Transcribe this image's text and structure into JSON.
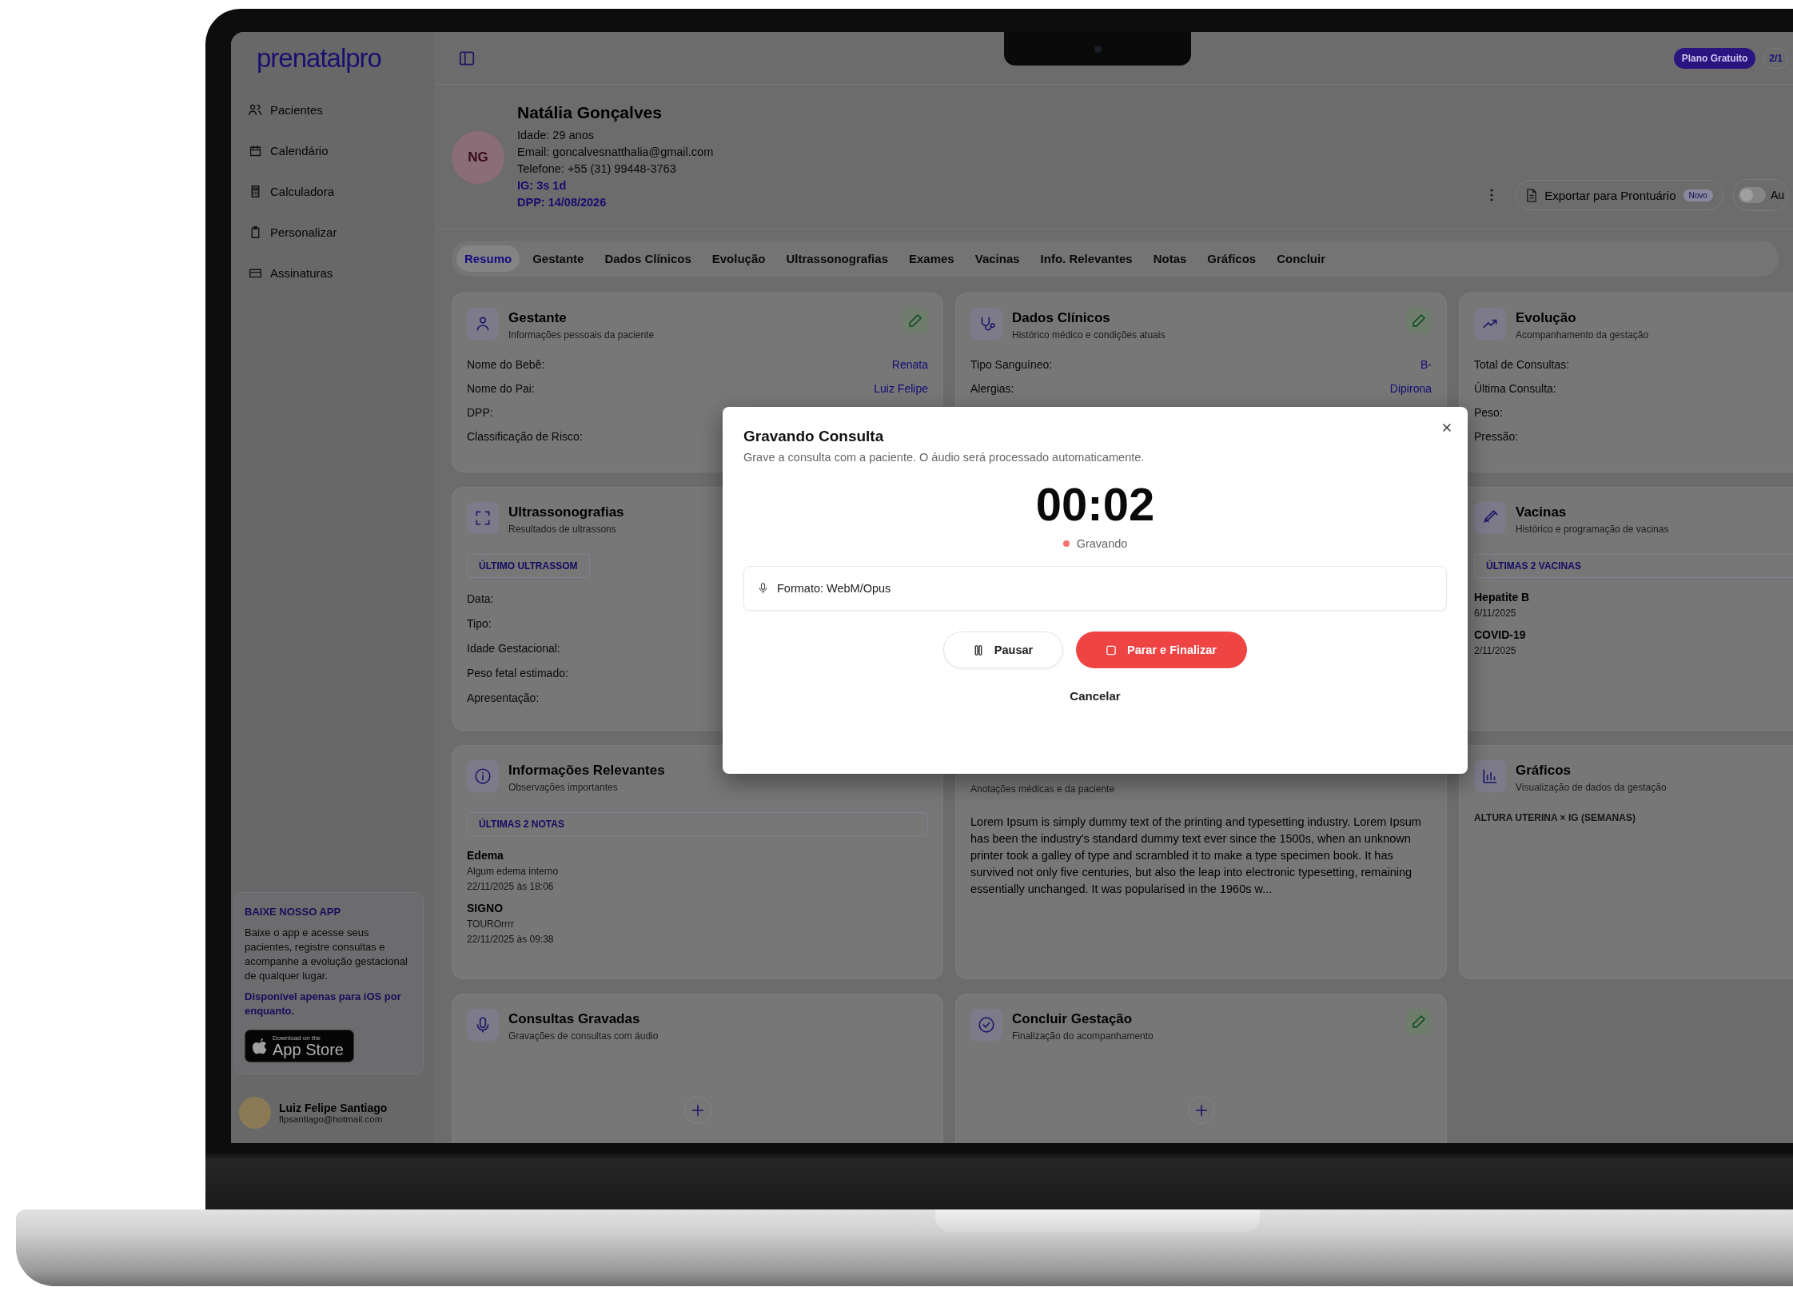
{
  "sidebar": {
    "logo": "prenatalpro",
    "nav": [
      {
        "label": "Pacientes"
      },
      {
        "label": "Calendário"
      },
      {
        "label": "Calculadora"
      },
      {
        "label": "Personalizar"
      },
      {
        "label": "Assinaturas"
      }
    ],
    "promo": {
      "title": "BAIXE NOSSO APP",
      "text": "Baixe o app e acesse seus pacientes, registre consultas e acompanhe a evolução gestacional de qualquer lugar.",
      "note": "Disponível apenas para iOS por enquanto.",
      "badge_caption": "Download on the",
      "badge_name": "App Store"
    },
    "user": {
      "name": "Luiz Felipe Santiago",
      "email": "flpsantiago@hotmail.com"
    }
  },
  "topbar": {
    "plan": "Plano Gratuito",
    "counter": "2/1"
  },
  "patient": {
    "initials": "NG",
    "name": "Natália Gonçalves",
    "details": [
      {
        "text": "Idade: 29 anos",
        "highlight": false
      },
      {
        "text": "Email: goncalvesnatthalia@gmail.com",
        "highlight": false
      },
      {
        "text": "Telefone: +55 (31) 99448-3763",
        "highlight": false
      },
      {
        "text": "IG: 3s 1d",
        "highlight": true
      },
      {
        "text": "DPP: 14/08/2026",
        "highlight": true
      }
    ]
  },
  "actions": {
    "export": "Exportar para Prontuário",
    "export_badge": "Novo",
    "toggle": {
      "on": false,
      "label": "Au"
    }
  },
  "tabs": [
    {
      "label": "Resumo",
      "selected": true
    },
    {
      "label": "Gestante",
      "selected": false
    },
    {
      "label": "Dados Clínicos",
      "selected": false
    },
    {
      "label": "Evolução",
      "selected": false
    },
    {
      "label": "Ultrassonografias",
      "selected": false
    },
    {
      "label": "Exames",
      "selected": false
    },
    {
      "label": "Vacinas",
      "selected": false
    },
    {
      "label": "Info. Relevantes",
      "selected": false
    },
    {
      "label": "Notas",
      "selected": false
    },
    {
      "label": "Gráficos",
      "selected": false
    },
    {
      "label": "Concluir",
      "selected": false
    }
  ],
  "cards": [
    {
      "kind": "fields",
      "title": "Gestante",
      "subtitle": "Informações pessoais da paciente",
      "editable": true,
      "fields": [
        {
          "label": "Nome do Bebê:",
          "value": "Renata"
        },
        {
          "label": "Nome do Pai:",
          "value": "Luiz Felipe"
        },
        {
          "label": "DPP:"
        },
        {
          "label": "Classificação de Risco:"
        }
      ]
    },
    {
      "kind": "fields",
      "title": "Dados Clínicos",
      "subtitle": "Histórico médico e condições atuais",
      "editable": true,
      "fields": [
        {
          "label": "Tipo Sanguíneo:",
          "value": "B-"
        },
        {
          "label": "Alergias:",
          "value": "Dipirona"
        }
      ]
    },
    {
      "kind": "fields",
      "title": "Evolução",
      "subtitle": "Acompanhamento da gestação",
      "fields": [
        {
          "label": "Total de Consultas:"
        },
        {
          "label": "Última Consulta:"
        },
        {
          "label": "Peso:"
        },
        {
          "label": "Pressão:"
        }
      ]
    },
    {
      "kind": "fields",
      "title": "Ultrassonografias",
      "subtitle": "Resultados de ultrassons",
      "section": "ÚLTIMO ULTRASSOM",
      "fields": [
        {
          "label": "Data:"
        },
        {
          "label": "Tipo:"
        },
        {
          "label": "Idade Gestacional:"
        },
        {
          "label": "Peso fetal estimado:"
        },
        {
          "label": "Apresentação:"
        }
      ]
    },
    {
      "kind": "entries",
      "title": "Vacinas",
      "subtitle": "Histórico e programação de vacinas",
      "section": "ÚLTIMAS 2 VACINAS",
      "entries": [
        {
          "title": "Hepatite B",
          "lines": [
            "6/11/2025"
          ]
        },
        {
          "title": "COVID-19",
          "lines": [
            "2/11/2025"
          ]
        }
      ]
    },
    {
      "kind": "entries",
      "title": "Informações Relevantes",
      "subtitle": "Observações importantes",
      "editable": false,
      "section": "ÚLTIMAS 2 NOTAS",
      "entries": [
        {
          "title": "Edema",
          "lines": [
            "Algum edema interno",
            "22/11/2025 às 18:06"
          ]
        },
        {
          "title": "SIGNO",
          "lines": [
            "TOUROrrrr",
            "22/11/2025 às 09:38"
          ]
        }
      ]
    },
    {
      "kind": "text",
      "subtitle": "Anotações médicas e da paciente",
      "editable": false,
      "text": "Lorem Ipsum is simply dummy text of the printing and typesetting industry. Lorem Ipsum has been the industry's standard dummy text ever since the 1500s, when an unknown printer took a galley of type and scrambled it to make a type specimen book. It has survived not only five centuries, but also the leap into electronic typesetting, remaining essentially unchanged. It was popularised in the 1960s w..."
    },
    {
      "kind": "chart",
      "title": "Gráficos",
      "subtitle": "Visualização de dados da gestação",
      "section": "ALTURA UTERINA × IG (SEMANAS)"
    },
    {
      "kind": "add",
      "title": "Consultas Gravadas",
      "subtitle": "Gravações de consultas com áudio",
      "editable": false
    },
    {
      "kind": "add",
      "title": "Concluir Gestação",
      "subtitle": "Finalização do acompanhamento",
      "editable": true
    }
  ],
  "modal": {
    "title": "Gravando Consulta",
    "subtitle": "Grave a consulta com a paciente. O áudio será processado automaticamente.",
    "timer": "00:02",
    "status": {
      "label": "Gravando",
      "recording": true
    },
    "format": "Formato: WebM/Opus",
    "buttons": {
      "pause": "Pausar",
      "stop": "Parar e Finalizar",
      "cancel": "Cancelar"
    }
  }
}
